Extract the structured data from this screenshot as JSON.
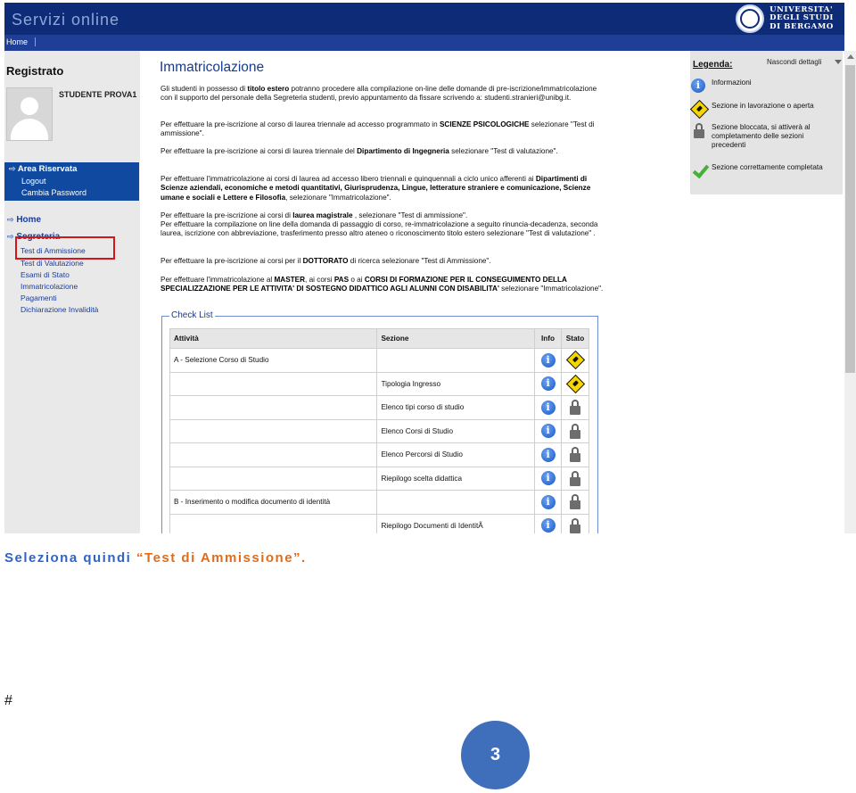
{
  "header": {
    "brand": "Servizi online",
    "university_lines": [
      "UNIVERSITA'",
      "DEGLI STUDI",
      "DI BERGAMO"
    ],
    "nav_home": "Home"
  },
  "sidebar": {
    "title": "Registrato",
    "student_name": "STUDENTE PROVA1",
    "area_title": "Area Riservata",
    "area_links": [
      "Logout",
      "Cambia Password"
    ],
    "home": "Home",
    "segreteria": "Segreteria",
    "segreteria_items": [
      "Test di Ammissione",
      "Test di Valutazione",
      "Esami di Stato",
      "Immatricolazione",
      "Pagamenti",
      "Dichiarazione Invalidità"
    ]
  },
  "main": {
    "title": "Immatricolazione",
    "intro": [
      "Gli studenti in possesso di ",
      "titolo estero",
      " potranno procedere alla compilazione on-line delle domande di pre-iscrizione/immatricolazione con il supporto del personale della Segreteria studenti, previo appuntamento da fissare scrivendo a: studenti.stranieri@unibg.it."
    ],
    "p_psicologiche": [
      "Per effettuare la pre-iscrizione al corso di laurea triennale ad accesso programmato in ",
      "SCIENZE PSICOLOGICHE",
      " selezionare \"Test di ammissione\"."
    ],
    "p_ingegneria": [
      "Per effettuare la pre-iscrizione ai corsi di laurea triennale del ",
      "Dipartimento di Ingegneria",
      " selezionare \"Test di valutazione\"."
    ],
    "p_libero": [
      "Per effettuare l'immatricolazione ai corsi di laurea ad accesso libero triennali e quinquennali a ciclo unico afferenti ai ",
      "Dipartimenti di Scienze aziendali, economiche e metodi quantitativi, Giurisprudenza, Lingue, letterature straniere e comunicazione, Scienze umane e sociali e Lettere e Filosofia",
      ", selezionare \"Immatricolazione\"."
    ],
    "p_magistrale": [
      "Per effettuare la pre-iscrizione ai corsi di ",
      "laurea magistrale",
      " , selezionare \"Test di ammissione\"."
    ],
    "p_rinuncia": "Per effettuare la compilazione on line della domanda di passaggio di corso, re-immatricolazione a seguito rinuncia-decadenza, seconda laurea, iscrizione con abbreviazione, trasferimento presso altro ateneo o riconoscimento titolo estero selezionare \"Test di valutazione\" .",
    "p_dottorato": [
      "Per effettuare la pre-iscrizione ai corsi per il ",
      "DOTTORATO",
      " di ricerca selezionare \"Test di Ammissione\"."
    ],
    "p_master": [
      "Per effettuare l'immatricolazione al ",
      "MASTER",
      ", ai corsi ",
      "PAS",
      " o ai ",
      "CORSI DI FORMAZIONE PER IL CONSEGUIMENTO DELLA SPECIALIZZAZIONE PER LE ATTIVITA' DI SOSTEGNO DIDATTICO AGLI ALUNNI CON DISABILITA'",
      " selezionare \"Immatricolazione\"."
    ]
  },
  "legend": {
    "title": "Legenda:",
    "toggle": "Nascondi dettagli",
    "items": [
      {
        "icon": "info-icon",
        "text": "Informazioni"
      },
      {
        "icon": "work-in-progress-icon",
        "text": "Sezione in lavorazione o aperta"
      },
      {
        "icon": "lock-icon",
        "text": "Sezione bloccata, si attiverà al completamento delle sezioni precedenti"
      },
      {
        "icon": "checkmark-icon",
        "text": "Sezione correttamente completata"
      }
    ]
  },
  "checklist": {
    "title": "Check List",
    "headers": [
      "Attività",
      "Sezione",
      "Info",
      "Stato"
    ],
    "rows": [
      {
        "attivita": "A - Selezione Corso di Studio",
        "sezione": "",
        "stato": "open"
      },
      {
        "attivita": "",
        "sezione": "Tipologia Ingresso",
        "stato": "open"
      },
      {
        "attivita": "",
        "sezione": "Elenco tipi corso di studio",
        "stato": "locked"
      },
      {
        "attivita": "",
        "sezione": "Elenco Corsi di Studio",
        "stato": "locked"
      },
      {
        "attivita": "",
        "sezione": "Elenco Percorsi di Studio",
        "stato": "locked"
      },
      {
        "attivita": "",
        "sezione": "Riepilogo scelta didattica",
        "stato": "locked"
      },
      {
        "attivita": "B - Inserimento o modifica documento di identità",
        "sezione": "",
        "stato": "locked"
      },
      {
        "attivita": "",
        "sezione": "Riepilogo Documenti di IdentitÃ",
        "stato": "locked"
      }
    ]
  },
  "caption": {
    "prefix": "Seleziona quindi ",
    "highlight": "“Test di Ammissione”."
  },
  "footer": {
    "hash": "#",
    "page_number": "3"
  }
}
